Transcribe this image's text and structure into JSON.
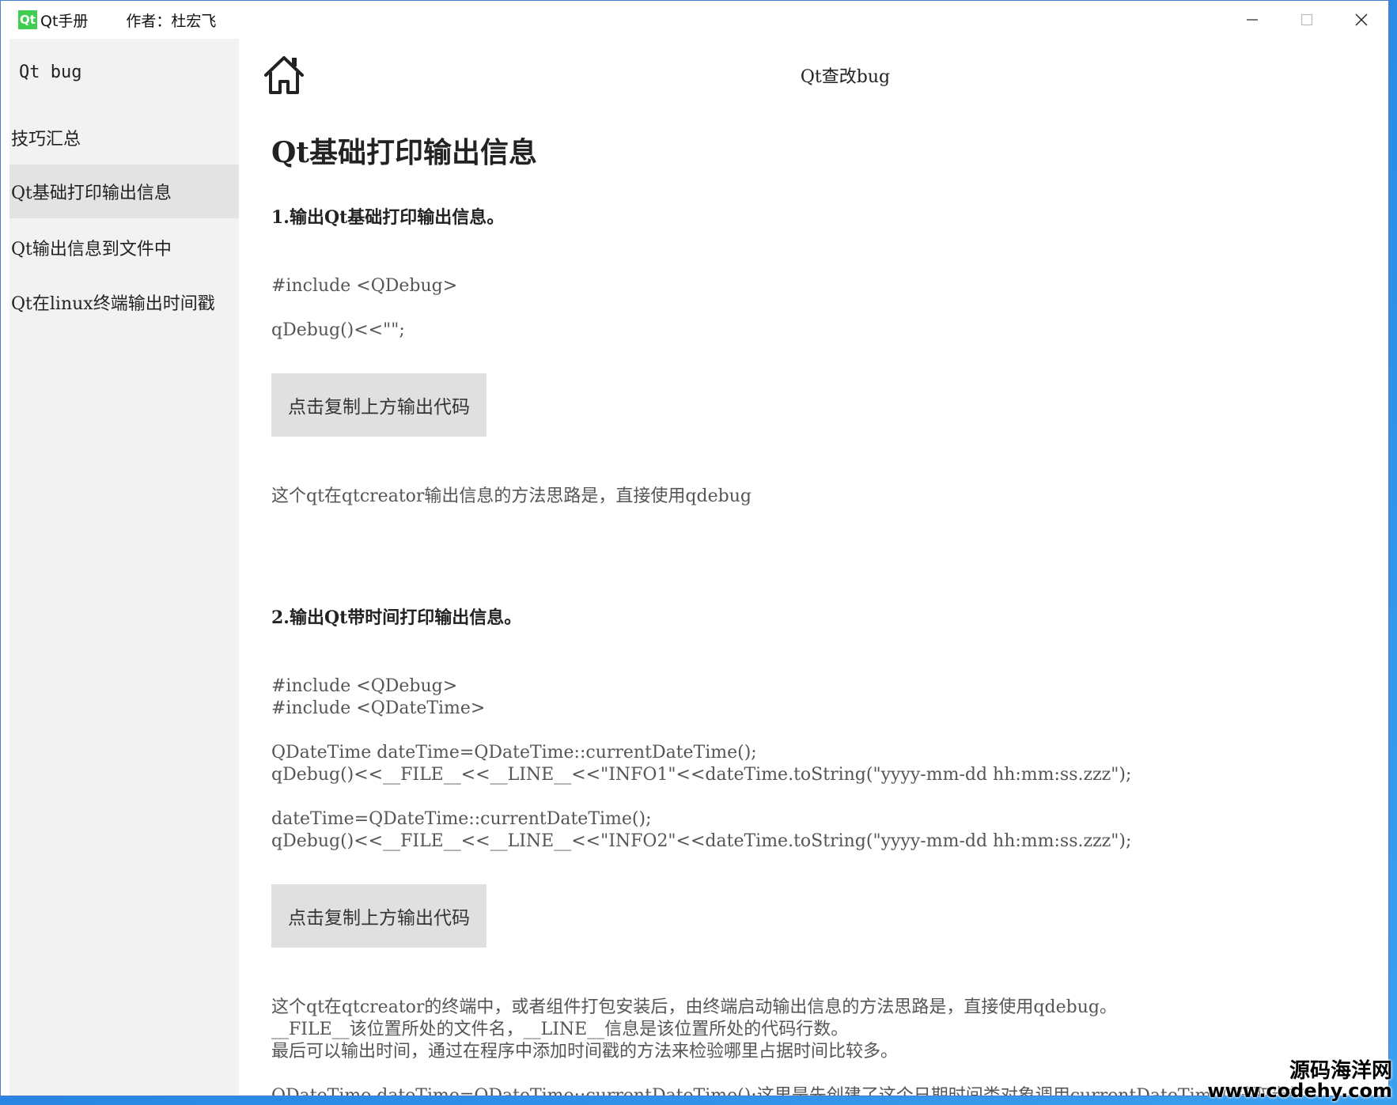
{
  "titlebar": {
    "logo_text": "Qt",
    "app_name": "Qt手册",
    "author": "作者：杜宏飞",
    "controls": [
      "minimize-icon",
      "maximize-icon",
      "close-icon"
    ]
  },
  "sidebar": {
    "header": "Qt bug",
    "items": [
      {
        "label": "技巧汇总",
        "active": false
      },
      {
        "label": "Qt基础打印输出信息",
        "active": true
      },
      {
        "label": "Qt输出信息到文件中",
        "active": false
      },
      {
        "label": "Qt在linux终端输出时间戳",
        "active": false
      }
    ]
  },
  "main": {
    "home_icon": "home-icon",
    "header_title": "Qt查改bug",
    "doc_title": "Qt基础打印输出信息",
    "section1": {
      "heading": "1.输出Qt基础打印输出信息。",
      "code": [
        "#include <QDebug>",
        "qDebug()<<\"\";"
      ],
      "copy_button": "点击复制上方输出代码",
      "description": [
        "这个qt在qtcreator输出信息的方法思路是，直接使用qdebug"
      ]
    },
    "section2": {
      "heading": "2.输出Qt带时间打印输出信息。",
      "code": [
        "#include <QDebug>",
        "#include <QDateTime>",
        "QDateTime dateTime=QDateTime::currentDateTime();",
        "qDebug()<<__FILE__<<__LINE__<<\"INFO1\"<<dateTime.toString(\"yyyy-mm-dd hh:mm:ss.zzz\");",
        "dateTime=QDateTime::currentDateTime();",
        "qDebug()<<__FILE__<<__LINE__<<\"INFO2\"<<dateTime.toString(\"yyyy-mm-dd hh:mm:ss.zzz\");"
      ],
      "copy_button": "点击复制上方输出代码",
      "description": [
        "这个qt在qtcreator的终端中，或者组件打包安装后，由终端启动输出信息的方法思路是，直接使用qdebug。",
        "__FILE__该位置所处的文件名，__LINE__信息是该位置所处的代码行数。",
        "最后可以输出时间，通过在程序中添加时间戳的方法来检验哪里占据时间比较多。",
        "QDateTime dateTime=QDateTime::currentDateTime();这里是先创建了这个日期时间类对象调用currentDateTime()获取当前"
      ]
    }
  },
  "watermark": {
    "cn": "源码海洋网",
    "url": "www.codehy.com"
  }
}
